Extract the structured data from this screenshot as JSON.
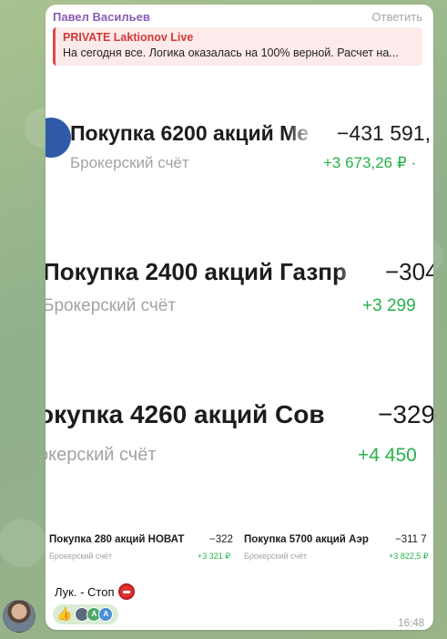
{
  "message": {
    "sender": "Павел Васильев",
    "reply_label": "Ответить",
    "quote": {
      "title": "PRIVATE Laktionov Live",
      "text": "На сегодня все.  Логика оказалась на 100% верной. Расчет на..."
    },
    "caption": "Лук. - Стоп",
    "time": "16:48",
    "reactions": {
      "emoji": "👍",
      "avatars": [
        "A",
        "A"
      ]
    }
  },
  "screenshot": {
    "rows": [
      {
        "title": "Покупка 6200 акций Ме",
        "sub": "Брокерский счёт",
        "amount": "−431 591,",
        "change": "+3 673,26 ₽ ·"
      },
      {
        "title": "Покупка 2400 акций Газпр",
        "sub": "Брокерский счёт",
        "amount": "−304",
        "change": "+3 299"
      },
      {
        "title": "окупка 4260 акций Сов",
        "sub": "окерский счёт",
        "amount": "−329",
        "change": "+4 450"
      },
      {
        "title": "Покупка 280 акций НОВАТ",
        "sub": "Брокерский счёт",
        "amount": "−322",
        "change": "+3 321 ₽"
      },
      {
        "title": "Покупка 5700 акций Аэр",
        "sub": "Брокерский счёт",
        "amount": "−311 7",
        "change": "+3 822,5 ₽"
      }
    ]
  },
  "colors": {
    "sender": "#8a5bb8",
    "quote_accent": "#e04848",
    "positive": "#26b24b",
    "chat_bg": "#9bb68a"
  }
}
